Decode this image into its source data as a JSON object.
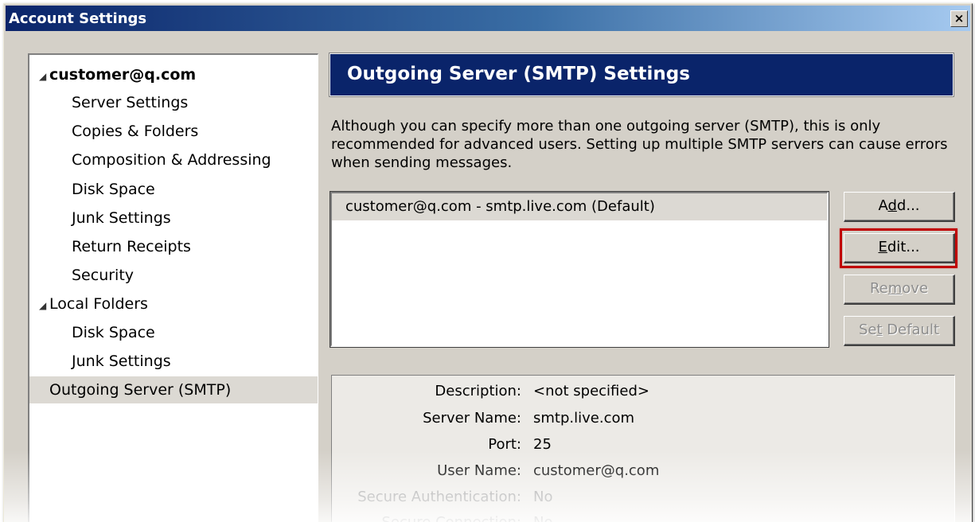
{
  "window": {
    "title": "Account Settings",
    "close_glyph": "×",
    "close_icon": "close-icon"
  },
  "tree": {
    "items": [
      {
        "label": "customer@q.com",
        "expander": "◢"
      },
      {
        "label": "Server Settings"
      },
      {
        "label": "Copies & Folders"
      },
      {
        "label": "Composition & Addressing"
      },
      {
        "label": "Disk Space"
      },
      {
        "label": "Junk Settings"
      },
      {
        "label": "Return Receipts"
      },
      {
        "label": "Security"
      },
      {
        "label": "Local Folders",
        "expander": "◢"
      },
      {
        "label": "Disk Space"
      },
      {
        "label": "Junk Settings"
      },
      {
        "label": "Outgoing Server (SMTP)",
        "selected": true
      }
    ]
  },
  "main": {
    "header": "Outgoing Server (SMTP) Settings",
    "description": "Although you can specify more than one outgoing server (SMTP), this is only recommended for advanced users. Setting up multiple SMTP servers can cause errors when sending messages.",
    "servers": [
      {
        "label": "customer@q.com - smtp.live.com (Default)",
        "selected": true
      }
    ],
    "buttons": {
      "add": {
        "label": "Add...",
        "mnemonic": "d"
      },
      "edit": {
        "label": "Edit...",
        "mnemonic": "E"
      },
      "remove": {
        "label": "Remove",
        "mnemonic": "m",
        "disabled": true
      },
      "set_default": {
        "label": "Set Default",
        "mnemonic": "t",
        "disabled": true
      }
    },
    "details": [
      {
        "label": "Description:",
        "value": "<not specified>"
      },
      {
        "label": "Server Name:",
        "value": "smtp.live.com"
      },
      {
        "label": "Port:",
        "value": "25"
      },
      {
        "label": "User Name:",
        "value": "customer@q.com"
      },
      {
        "label": "Secure Authentication:",
        "value": "No",
        "dim": true
      },
      {
        "label": "Secure Connection:",
        "value": "No",
        "dim": true
      }
    ]
  },
  "colors": {
    "header_bg": "#0a246a",
    "highlight_border": "#c00000",
    "selected_row": "#dcd9d3"
  }
}
